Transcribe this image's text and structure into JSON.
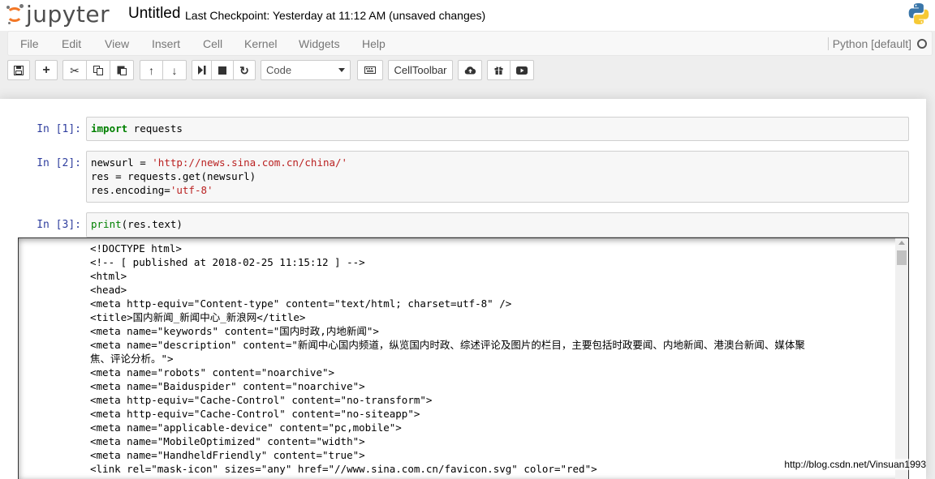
{
  "header": {
    "logo_text": "jupyter",
    "notebook_title": "Untitled",
    "checkpoint": "Last Checkpoint: Yesterday at 11:12 AM (unsaved changes)"
  },
  "menu": {
    "items": [
      "File",
      "Edit",
      "View",
      "Insert",
      "Cell",
      "Kernel",
      "Widgets",
      "Help"
    ],
    "kernel_name": "Python [default]"
  },
  "toolbar": {
    "cell_type": "Code",
    "celltoolbar_label": "CellToolbar",
    "icons": [
      "save-icon",
      "plus-icon",
      "cut-icon",
      "copy-icon",
      "paste-icon",
      "arrow-up-icon",
      "arrow-down-icon",
      "step-forward-icon",
      "stop-icon",
      "restart-icon",
      "keyboard-icon",
      "cloud-upload-icon",
      "gift-icon",
      "youtube-icon"
    ]
  },
  "cells": [
    {
      "prompt": "In [1]:",
      "lines": [
        [
          [
            "kw",
            "import"
          ],
          [
            "",
            " requests"
          ]
        ]
      ]
    },
    {
      "prompt": "In [2]:",
      "lines": [
        [
          [
            "",
            "newsurl = "
          ],
          [
            "str",
            "'http://news.sina.com.cn/china/'"
          ]
        ],
        [
          [
            "",
            "res = requests.get(newsurl)"
          ]
        ],
        [
          [
            "",
            "res.encoding="
          ],
          [
            "str",
            "'utf-8'"
          ]
        ]
      ]
    },
    {
      "prompt": "In [3]:",
      "lines": [
        [
          [
            "bi",
            "print"
          ],
          [
            "",
            "(res.text)"
          ]
        ]
      ]
    }
  ],
  "output": {
    "lines": [
      "<!DOCTYPE html>",
      "<!-- [ published at 2018-02-25 11:15:12 ] -->",
      "<html>",
      "<head>",
      "<meta http-equiv=\"Content-type\" content=\"text/html; charset=utf-8\" />",
      "<title>国内新闻_新闻中心_新浪网</title>",
      "<meta name=\"keywords\" content=\"国内时政,内地新闻\">",
      "<meta name=\"description\" content=\"新闻中心国内频道，纵览国内时政、综述评论及图片的栏目，主要包括时政要闻、内地新闻、港澳台新闻、媒体聚",
      "焦、评论分析。\">",
      "<meta name=\"robots\" content=\"noarchive\">",
      "<meta name=\"Baiduspider\" content=\"noarchive\">",
      "<meta http-equiv=\"Cache-Control\" content=\"no-transform\">",
      "<meta http-equiv=\"Cache-Control\" content=\"no-siteapp\">",
      "<meta name=\"applicable-device\" content=\"pc,mobile\">",
      "<meta name=\"MobileOptimized\" content=\"width\">",
      "<meta name=\"HandheldFriendly\" content=\"true\">",
      "<link rel=\"mask-icon\" sizes=\"any\" href=\"//www.sina.com.cn/favicon.svg\" color=\"red\">"
    ]
  },
  "watermark": "http://blog.csdn.net/Vinsuan1993"
}
